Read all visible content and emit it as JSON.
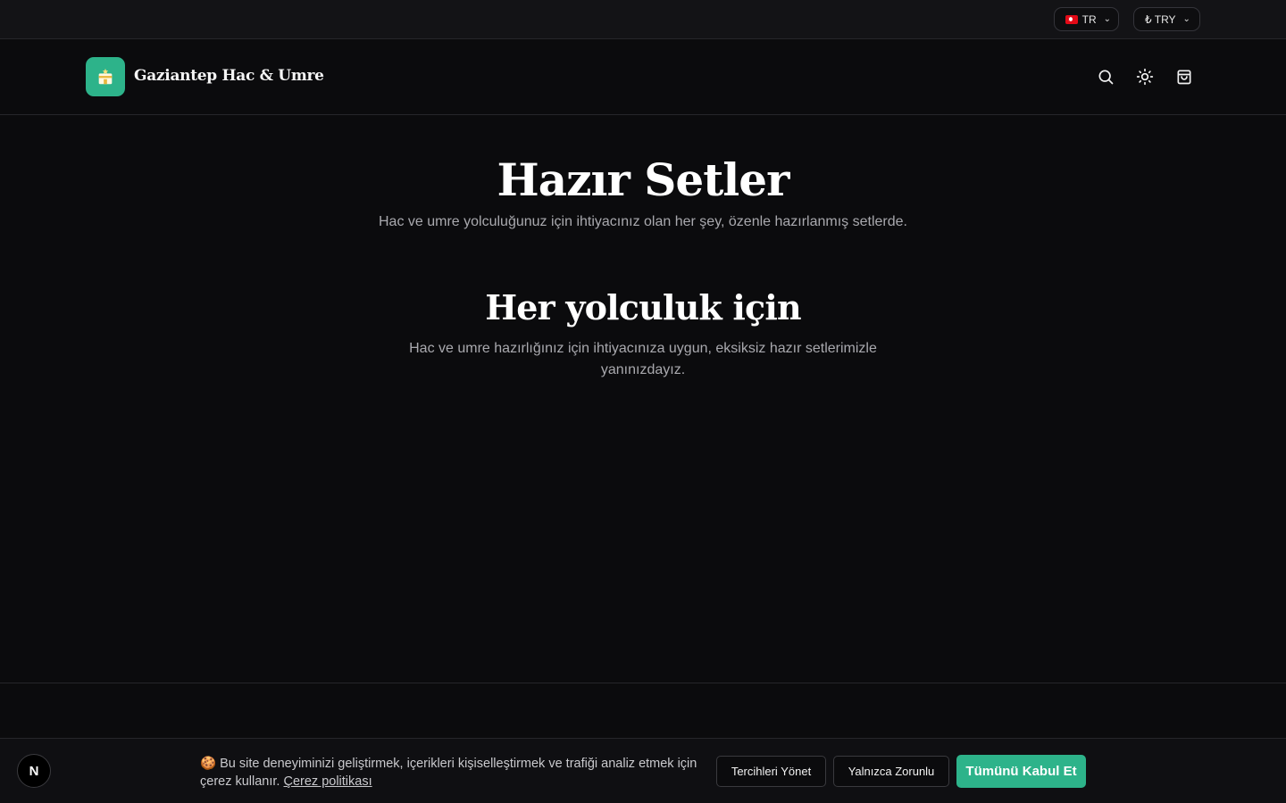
{
  "topbar": {
    "language": {
      "label": "TR",
      "flag": "turkey-flag-icon"
    },
    "currency": {
      "label": "₺ TRY"
    }
  },
  "header": {
    "brand_name": "Gaziantep Hac & Umre",
    "logo_icon": "kaaba-icon",
    "icons": [
      "search-icon",
      "sun-icon",
      "shopping-bag-icon"
    ]
  },
  "main": {
    "page_title": "Hazır Setler",
    "page_subtitle": "Hac ve umre yolculuğunuz için ihtiyacınız olan her şey, özenle hazırlanmış setlerde.",
    "section_title": "Her yolculuk için",
    "section_desc": "Hac ve umre hazırlığınız için ihtiyacınıza uygun, eksiksiz hazır setlerimizle yanınızdayız."
  },
  "cookie_banner": {
    "emoji": "🍪",
    "text": "Bu site deneyiminizi geliştirmek, içerikleri kişiselleştirmek ve trafiği analiz etmek için çerez kullanır.",
    "policy_link": "Çerez politikası",
    "manage_label": "Tercihleri Yönet",
    "necessary_label": "Yalnızca Zorunlu",
    "accept_label": "Tümünü Kabul Et"
  },
  "dev_badge": {
    "label": "N"
  },
  "colors": {
    "background": "#0b0b0d",
    "accent": "#2db38a",
    "muted_text": "#a9a9ae",
    "border": "#26262a"
  }
}
